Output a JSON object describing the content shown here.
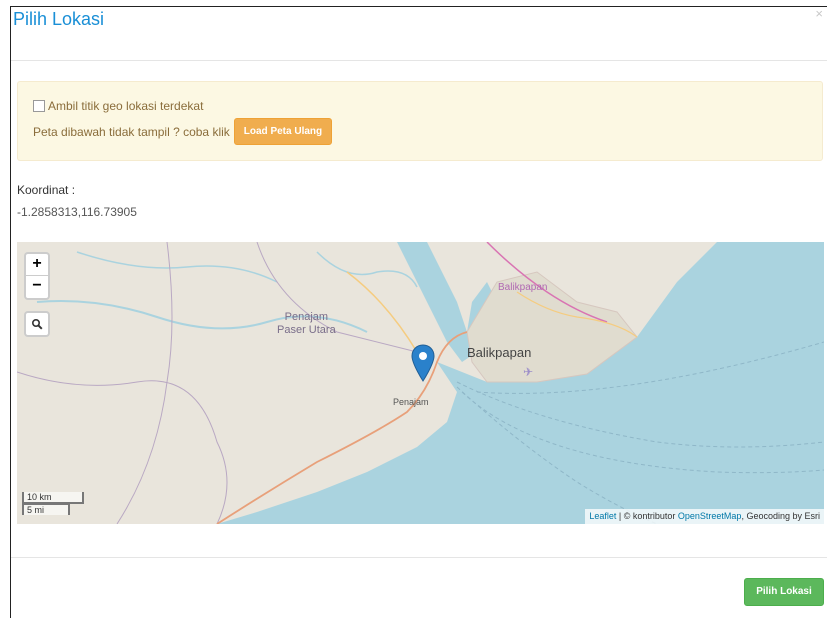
{
  "modal": {
    "title": "Pilih Lokasi",
    "close_glyph": "×"
  },
  "alert": {
    "checkbox_label": "Ambil titik geo lokasi terdekat",
    "checkbox_checked": false,
    "reload_text": "Peta dibawah tidak tampil ? coba klik",
    "reload_button": "Load Peta Ulang"
  },
  "coordinates": {
    "label": "Koordinat :",
    "value": "-1.2858313,116.73905"
  },
  "map": {
    "zoom_in": "+",
    "zoom_out": "−",
    "labels": {
      "penajam_paser_utara": "Penajam\nPaser Utara",
      "balikpapan_big": "Balikpapan",
      "balikpapan_small": "Balikpapan",
      "penajam": "Penajam"
    },
    "scale": {
      "metric": "10 km",
      "imperial": "5 mi"
    },
    "attribution": {
      "leaflet": "Leaflet",
      "sep": " | © kontributor ",
      "osm": "OpenStreetMap",
      "geocoding": ", Geocoding by Esri"
    },
    "colors": {
      "water": "#aad3df",
      "land": "#e9e5dc",
      "marker": "#2a81cb"
    }
  },
  "footer": {
    "submit_button": "Pilih Lokasi"
  }
}
